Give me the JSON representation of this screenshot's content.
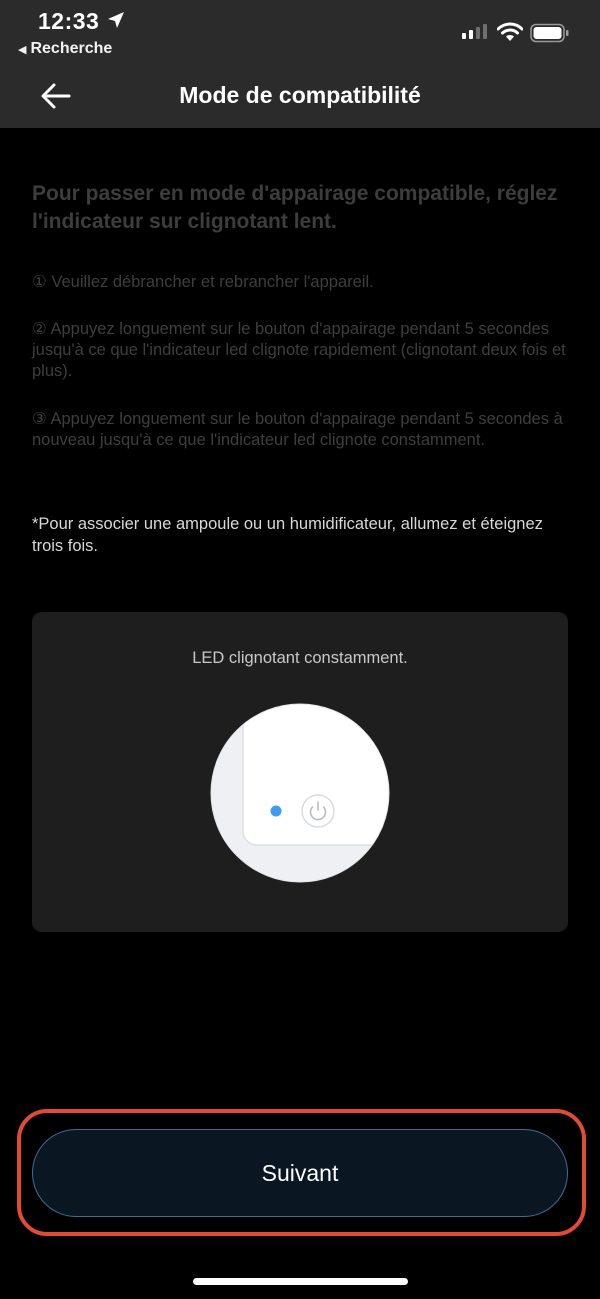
{
  "status_bar": {
    "time": "12:33",
    "back_app": "Recherche"
  },
  "header": {
    "title": "Mode de compatibilité",
    "back_icon": "arrow-left-icon"
  },
  "instructions": {
    "headline": "Pour passer en mode d'appairage compatible, réglez l'indicateur sur clignotant lent.",
    "steps": [
      "① Veuillez débrancher et rebrancher l'appareil.",
      "② Appuyez longuement sur le bouton d'appairage pendant 5 secondes jusqu'à ce que l'indicateur led clignote rapidement (clignotant deux fois et plus).",
      "③ Appuyez longuement sur le bouton d'appairage pendant 5 secondes à nouveau jusqu'à ce que l'indicateur led clignote constamment."
    ],
    "note": "*Pour associer une ampoule ou un humidificateur, allumez et éteignez trois fois."
  },
  "card": {
    "label": "LED clignotant constamment."
  },
  "footer": {
    "next_label": "Suivant"
  },
  "colors": {
    "accent_border": "#3d6f93",
    "highlight": "#e04a36",
    "led": "#3b9cf0"
  }
}
